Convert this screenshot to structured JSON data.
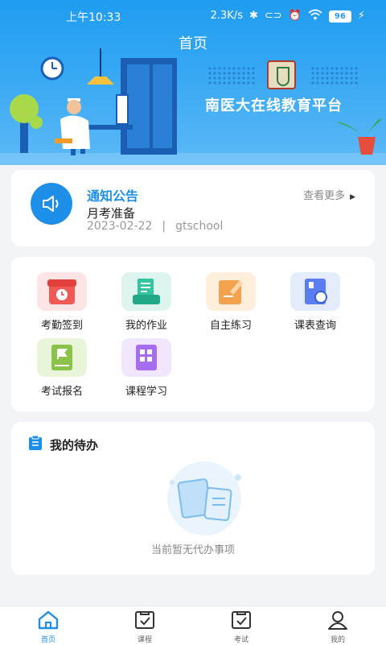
{
  "status_bar": {
    "time": "上午10:33",
    "network_speed": "2.3K/s",
    "battery": "96",
    "icons": [
      "bluetooth-icon",
      "link-icon",
      "alarm-icon",
      "hd-icon",
      "wifi-icon",
      "battery-icon",
      "charging-icon"
    ]
  },
  "header": {
    "title": "首页"
  },
  "banner": {
    "title": "南医大在线教育平台"
  },
  "notice": {
    "title": "通知公告",
    "more_label": "查看更多",
    "headline": "月考准备",
    "date": "2023-02-22",
    "separator": "|",
    "source": "gtschool"
  },
  "features": [
    {
      "label": "考勤签到",
      "icon": "attendance-icon",
      "color": "#ef5a57"
    },
    {
      "label": "我的作业",
      "icon": "homework-icon",
      "color": "#33c4a0"
    },
    {
      "label": "自主练习",
      "icon": "practice-icon",
      "color": "#f3a24d"
    },
    {
      "label": "课表查询",
      "icon": "timetable-icon",
      "color": "#5a7ef0"
    },
    {
      "label": "考试报名",
      "icon": "exam-signup-icon",
      "color": "#8bc34a"
    },
    {
      "label": "课程学习",
      "icon": "course-icon",
      "color": "#a76df0"
    }
  ],
  "todo": {
    "title": "我的待办",
    "empty_text": "当前暂无代办事项"
  },
  "tabs": [
    {
      "label": "首页",
      "icon": "home-icon",
      "active": true
    },
    {
      "label": "课程",
      "icon": "course-tab-icon",
      "active": false
    },
    {
      "label": "考试",
      "icon": "exam-tab-icon",
      "active": false
    },
    {
      "label": "我的",
      "icon": "profile-icon",
      "active": false
    }
  ],
  "colors": {
    "primary": "#1e8fe8",
    "background": "#f2f4f7"
  }
}
